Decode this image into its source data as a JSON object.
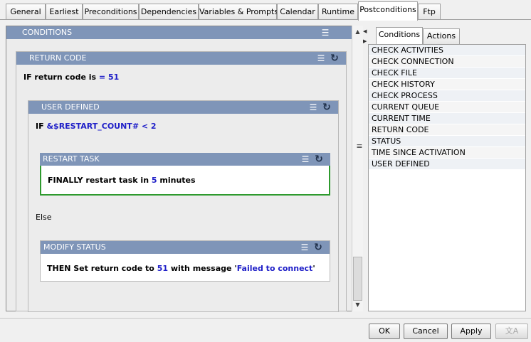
{
  "tabs": [
    "General",
    "Earliest",
    "Preconditions",
    "Dependencies",
    "Variables & Prompts",
    "Calendar",
    "Runtime",
    "Postconditions",
    "Ftp"
  ],
  "active_tab": "Postconditions",
  "conditions": {
    "title": "CONDITIONS",
    "return_code": {
      "title": "RETURN CODE",
      "prefix": "IF return code is",
      "operator": "=",
      "value": "51"
    },
    "user_defined": {
      "title": "USER DEFINED",
      "prefix": "IF",
      "expression": "&$RESTART_COUNT# < 2"
    },
    "restart_task": {
      "title": "RESTART TASK",
      "text_before": "FINALLY restart task in",
      "value": "5",
      "text_after": "minutes"
    },
    "else_label": "Else",
    "modify_status": {
      "title": "MODIFY STATUS",
      "text_before": "THEN Set return code to",
      "code": "51",
      "text_middle": "with message '",
      "message": "Failed to connect",
      "text_after": "'"
    }
  },
  "right_tabs": [
    "Conditions",
    "Actions"
  ],
  "condition_list": [
    "CHECK ACTIVITIES",
    "CHECK CONNECTION",
    "CHECK FILE",
    "CHECK HISTORY",
    "CHECK PROCESS",
    "CURRENT QUEUE",
    "CURRENT TIME",
    "RETURN CODE",
    "STATUS",
    "TIME SINCE ACTIVATION",
    "USER DEFINED"
  ],
  "buttons": {
    "ok": "OK",
    "cancel": "Cancel",
    "apply": "Apply"
  },
  "colors": {
    "header_bar": "#7f95b8",
    "value_blue": "#2020c8",
    "restart_border": "#2e9a2e"
  },
  "icons": {
    "list": "list-icon",
    "refresh": "refresh-icon",
    "translate": "translate-icon"
  }
}
